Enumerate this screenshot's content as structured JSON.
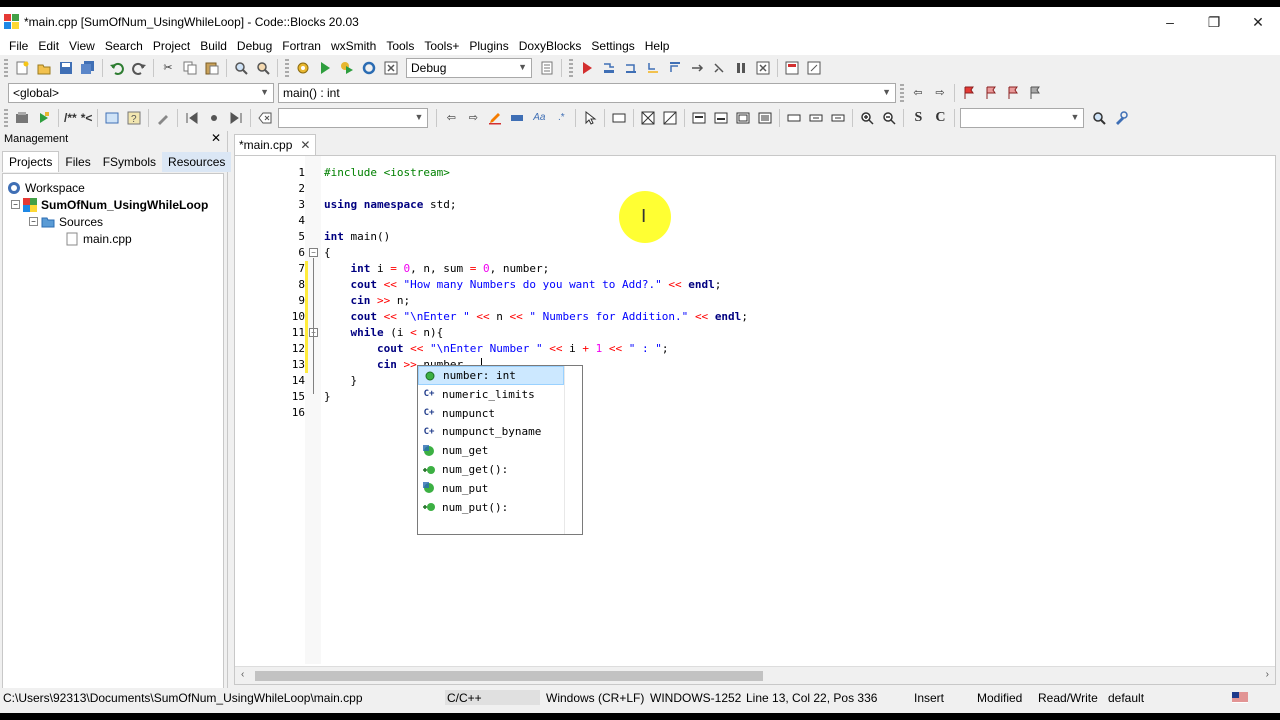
{
  "window": {
    "title": "*main.cpp [SumOfNum_UsingWhileLoop] - Code::Blocks 20.03",
    "controls": [
      "–",
      "❐",
      "✕"
    ]
  },
  "menu": [
    "File",
    "Edit",
    "View",
    "Search",
    "Project",
    "Build",
    "Debug",
    "Fortran",
    "wxSmith",
    "Tools",
    "Tools+",
    "Plugins",
    "DoxyBlocks",
    "Settings",
    "Help"
  ],
  "toolbar": {
    "build_target": "Debug",
    "scope": "<global>",
    "function": "main() : int",
    "doxy_comment": "/**",
    "doxy_inline": "*<",
    "search_text": "",
    "bold_s": "S",
    "bold_c": "C"
  },
  "management": {
    "title": "Management",
    "close": "✕",
    "tabs": [
      "Projects",
      "Files",
      "FSymbols",
      "Resources"
    ],
    "tree": {
      "workspace": "Workspace",
      "project": "SumOfNum_UsingWhileLoop",
      "folder": "Sources",
      "file": "main.cpp",
      "collapse_1": "−",
      "collapse_2": "−"
    }
  },
  "editor": {
    "tab_label": "*main.cpp",
    "tab_close": "✕",
    "line_numbers": [
      "1",
      "2",
      "3",
      "4",
      "5",
      "6",
      "7",
      "8",
      "9",
      "10",
      "11",
      "12",
      "13",
      "14",
      "15",
      "16"
    ],
    "lines": [
      [
        [
          "pp",
          "#include <iostream>"
        ]
      ],
      [],
      [
        [
          "kw",
          "using"
        ],
        [
          "t",
          " "
        ],
        [
          "kw",
          "namespace"
        ],
        [
          "t",
          " std;"
        ]
      ],
      [],
      [
        [
          "kw",
          "int"
        ],
        [
          "t",
          " main()"
        ]
      ],
      [
        [
          "t",
          "{"
        ]
      ],
      [
        [
          "t",
          "    "
        ],
        [
          "kw",
          "int"
        ],
        [
          "t",
          " i "
        ],
        [
          "op",
          "="
        ],
        [
          "t",
          " "
        ],
        [
          "num",
          "0"
        ],
        [
          "t",
          ", n, sum "
        ],
        [
          "op",
          "="
        ],
        [
          "t",
          " "
        ],
        [
          "num",
          "0"
        ],
        [
          "t",
          ", number;"
        ]
      ],
      [
        [
          "t",
          "    "
        ],
        [
          "kw",
          "cout"
        ],
        [
          "t",
          " "
        ],
        [
          "op",
          "<<"
        ],
        [
          "t",
          " "
        ],
        [
          "str",
          "\"How many Numbers do you want to Add?.\""
        ],
        [
          "t",
          " "
        ],
        [
          "op",
          "<<"
        ],
        [
          "t",
          " "
        ],
        [
          "kw",
          "endl"
        ],
        [
          "t",
          ";"
        ]
      ],
      [
        [
          "t",
          "    "
        ],
        [
          "kw",
          "cin"
        ],
        [
          "t",
          " "
        ],
        [
          "op",
          ">>"
        ],
        [
          "t",
          " n;"
        ]
      ],
      [
        [
          "t",
          "    "
        ],
        [
          "kw",
          "cout"
        ],
        [
          "t",
          " "
        ],
        [
          "op",
          "<<"
        ],
        [
          "t",
          " "
        ],
        [
          "str",
          "\"\\nEnter \""
        ],
        [
          "t",
          " "
        ],
        [
          "op",
          "<<"
        ],
        [
          "t",
          " n "
        ],
        [
          "op",
          "<<"
        ],
        [
          "t",
          " "
        ],
        [
          "str",
          "\" Numbers for Addition.\""
        ],
        [
          "t",
          " "
        ],
        [
          "op",
          "<<"
        ],
        [
          "t",
          " "
        ],
        [
          "kw",
          "endl"
        ],
        [
          "t",
          ";"
        ]
      ],
      [
        [
          "t",
          "    "
        ],
        [
          "kw",
          "while"
        ],
        [
          "t",
          " (i "
        ],
        [
          "op",
          "<"
        ],
        [
          "t",
          " n){"
        ]
      ],
      [
        [
          "t",
          "        "
        ],
        [
          "kw",
          "cout"
        ],
        [
          "t",
          " "
        ],
        [
          "op",
          "<<"
        ],
        [
          "t",
          " "
        ],
        [
          "str",
          "\"\\nEnter Number \""
        ],
        [
          "t",
          " "
        ],
        [
          "op",
          "<<"
        ],
        [
          "t",
          " i "
        ],
        [
          "op",
          "+"
        ],
        [
          "t",
          " "
        ],
        [
          "num",
          "1"
        ],
        [
          "t",
          " "
        ],
        [
          "op",
          "<<"
        ],
        [
          "t",
          " "
        ],
        [
          "str",
          "\" : \""
        ],
        [
          "t",
          ";"
        ]
      ],
      [
        [
          "t",
          "        "
        ],
        [
          "kw",
          "cin"
        ],
        [
          "t",
          " "
        ],
        [
          "op",
          ">>"
        ],
        [
          "t",
          " number"
        ]
      ],
      [
        [
          "t",
          "    }"
        ]
      ],
      [
        [
          "t",
          "}"
        ]
      ],
      []
    ],
    "fold_minus": "−",
    "scroll_left": "‹",
    "scroll_right": "›"
  },
  "autocomplete": {
    "items": [
      {
        "label": "number: int",
        "kind": "var"
      },
      {
        "label": "numeric_limits",
        "kind": "class"
      },
      {
        "label": "numpunct",
        "kind": "class"
      },
      {
        "label": "numpunct_byname",
        "kind": "class"
      },
      {
        "label": "num_get",
        "kind": "ns"
      },
      {
        "label": "num_get():",
        "kind": "func"
      },
      {
        "label": "num_put",
        "kind": "ns"
      },
      {
        "label": "num_put():",
        "kind": "func"
      }
    ],
    "class_glyph": "C+"
  },
  "status": {
    "path": "C:\\Users\\92313\\Documents\\SumOfNum_UsingWhileLoop\\main.cpp",
    "language": "C/C++",
    "eol": "Windows (CR+LF)",
    "encoding": "WINDOWS-1252",
    "position": "Line 13, Col 22, Pos 336",
    "mode": "Insert",
    "modified": "Modified",
    "access": "Read/Write",
    "profile": "default"
  },
  "colors": {
    "keyword": "#000080",
    "preprocessor": "#008000",
    "string": "#0000ff",
    "number": "#f000f0",
    "operator": "#ff0000",
    "changebar": "#ffeb3b",
    "cursor_highlight": "#ffff33"
  }
}
